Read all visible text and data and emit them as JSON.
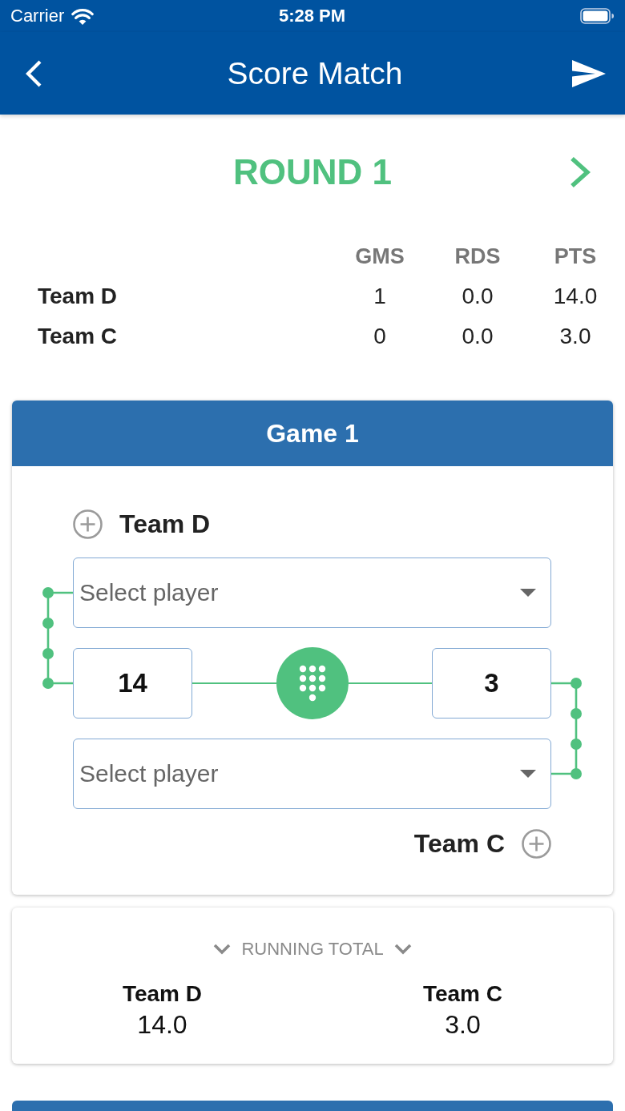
{
  "status_bar": {
    "carrier": "Carrier",
    "time": "5:28 PM"
  },
  "nav_bar": {
    "title": "Score Match"
  },
  "round": {
    "title": "ROUND 1"
  },
  "standings": {
    "columns": [
      "GMS",
      "RDS",
      "PTS"
    ],
    "rows": [
      {
        "team": "Team D",
        "cells": [
          "1",
          "0.0",
          "14.0"
        ]
      },
      {
        "team": "Team C",
        "cells": [
          "0",
          "0.0",
          "3.0"
        ]
      }
    ]
  },
  "game": {
    "title": "Game 1",
    "top_team": "Team D",
    "top_player_select": {
      "placeholder": "Select player"
    },
    "scores": [
      "14",
      "3"
    ],
    "bottom_player_select": {
      "placeholder": "Select player"
    },
    "bottom_team": "Team C"
  },
  "running_total": {
    "label": "RUNNING TOTAL",
    "teams": [
      {
        "name": "Team D",
        "total": "14.0"
      },
      {
        "name": "Team C",
        "total": "3.0"
      }
    ]
  }
}
